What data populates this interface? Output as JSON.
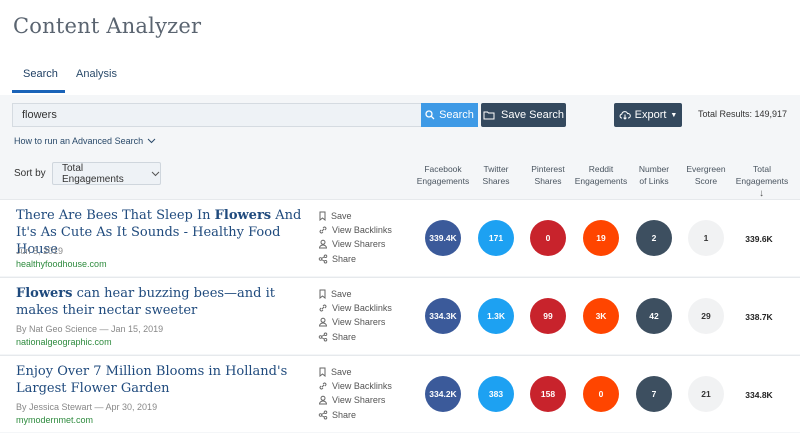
{
  "app": {
    "title": "Content Analyzer"
  },
  "tabs": [
    {
      "label": "Search",
      "active": true
    },
    {
      "label": "Analysis",
      "active": false
    }
  ],
  "search": {
    "value": "flowers",
    "placeholder": "",
    "button_label": "Search"
  },
  "save_search": {
    "label": "Save Search"
  },
  "export": {
    "label": "Export"
  },
  "total_results": "Total Results: 149,917",
  "advanced_search": {
    "label": "How to run an Advanced Search"
  },
  "sort": {
    "label": "Sort by",
    "selected": "Total Engagements"
  },
  "columns": [
    {
      "line1": "Facebook",
      "line2": "Engagements"
    },
    {
      "line1": "Twitter",
      "line2": "Shares"
    },
    {
      "line1": "Pinterest",
      "line2": "Shares"
    },
    {
      "line1": "Reddit",
      "line2": "Engagements"
    },
    {
      "line1": "Number",
      "line2": "of Links"
    },
    {
      "line1": "Evergreen",
      "line2": "Score"
    },
    {
      "line1": "Total",
      "line2": "Engagements"
    }
  ],
  "sort_arrow": "↓",
  "actions": {
    "save": "Save",
    "backlinks": "View Backlinks",
    "sharers": "View Sharers",
    "share": "Share"
  },
  "colors": {
    "facebook": "#3b5a9a",
    "twitter": "#1da1f2",
    "pinterest": "#c8232c",
    "reddit": "#ff4500",
    "links": "#3d4f60",
    "accent": "#3e9ae6",
    "dark_button": "#34495e"
  },
  "results": [
    {
      "title_bold": "Flowers",
      "title_pre": "There Are Bees That Sleep In ",
      "title_post": " And It's As Cute As It Sounds - Healthy Food House",
      "meta": "Jun 5, 2019",
      "domain": "healthyfoodhouse.com",
      "metrics": {
        "facebook": "339.4K",
        "twitter": "171",
        "pinterest": "0",
        "reddit": "19",
        "links": "2",
        "evergreen": "1",
        "total": "339.6K"
      }
    },
    {
      "title_bold": "Flowers",
      "title_pre": "",
      "title_post": " can hear buzzing bees—and it makes their nectar sweeter",
      "meta": "By Nat Geo Science — Jan 15, 2019",
      "domain": "nationalgeographic.com",
      "metrics": {
        "facebook": "334.3K",
        "twitter": "1.3K",
        "pinterest": "99",
        "reddit": "3K",
        "links": "42",
        "evergreen": "29",
        "total": "338.7K"
      }
    },
    {
      "title_bold": "",
      "title_pre": "Enjoy Over 7 Million Blooms in Holland's Largest Flower Garden",
      "title_post": "",
      "meta": "By Jessica Stewart — Apr 30, 2019",
      "domain": "mymodernmet.com",
      "metrics": {
        "facebook": "334.2K",
        "twitter": "383",
        "pinterest": "158",
        "reddit": "0",
        "links": "7",
        "evergreen": "21",
        "total": "334.8K"
      }
    }
  ]
}
